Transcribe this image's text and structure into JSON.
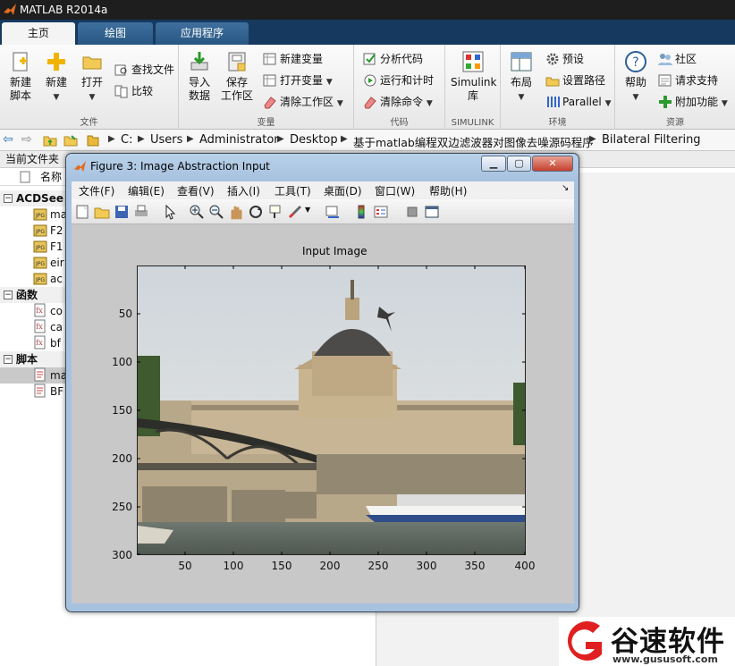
{
  "window": {
    "title": "MATLAB R2014a"
  },
  "tabs": [
    {
      "label": "主页"
    },
    {
      "label": "绘图"
    },
    {
      "label": "应用程序"
    }
  ],
  "ribbon": {
    "file": {
      "label": "文件",
      "new_script": "新建\n脚本",
      "new": "新建",
      "open": "打开",
      "find_files": "查找文件",
      "compare": "比较"
    },
    "variable": {
      "label": "变量",
      "import": "导入\n数据",
      "save_ws": "保存\n工作区",
      "new_var": "新建变量",
      "open_var": "打开变量",
      "clear_ws": "清除工作区"
    },
    "code": {
      "label": "代码",
      "analyze": "分析代码",
      "run_time": "运行和计时",
      "clear_cmd": "清除命令"
    },
    "simulink": {
      "label": "SIMULINK",
      "lib": "Simulink\n库"
    },
    "env": {
      "label": "环境",
      "layout": "布局",
      "prefs": "预设",
      "set_path": "设置路径",
      "parallel": "Parallel"
    },
    "resources": {
      "label": "资源",
      "help": "帮助",
      "community": "社区",
      "support": "请求支持",
      "addons": "附加功能"
    }
  },
  "address": {
    "crumbs": [
      "C:",
      "Users",
      "Administrator",
      "Desktop",
      "基于matlab编程双边滤波器对图像去噪源码程序",
      "Bilateral Filtering"
    ]
  },
  "browser": {
    "header": "当前文件夹",
    "col_name": "名称",
    "sections": [
      {
        "label": "ACDSee",
        "files": [
          "ma",
          "F2",
          "F1",
          "eir",
          "ac"
        ]
      },
      {
        "label": "函数",
        "files": [
          "co",
          "ca",
          "bf"
        ]
      },
      {
        "label": "脚本",
        "files": [
          "ma",
          "BF"
        ]
      }
    ]
  },
  "figure": {
    "title": "Figure 3: Image Abstraction Input",
    "menu": [
      "文件(F)",
      "编辑(E)",
      "查看(V)",
      "插入(I)",
      "工具(T)",
      "桌面(D)",
      "窗口(W)",
      "帮助(H)"
    ],
    "plot_title": "Input Image",
    "y_ticks": [
      "50",
      "100",
      "150",
      "200",
      "250",
      "300"
    ],
    "x_ticks": [
      "50",
      "100",
      "150",
      "200",
      "250",
      "300",
      "350",
      "400"
    ]
  },
  "watermark": {
    "brand": "谷速软件",
    "url": "www.gususoft.com"
  },
  "colors": {
    "accent": "#16395f",
    "figure_frame": "#a7c2df",
    "watermark_red": "#e02020"
  }
}
